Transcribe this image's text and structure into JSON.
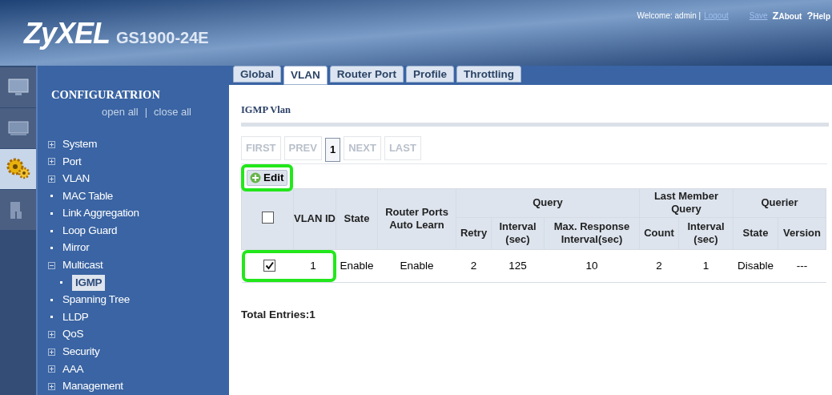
{
  "header": {
    "brand": "ZyXEL",
    "model": "GS1900-24E",
    "welcome": "Welcome: admin |",
    "logout": "Logout",
    "links": [
      {
        "label": "Save"
      },
      {
        "icon": "Z",
        "label": "About"
      },
      {
        "icon": "?",
        "label": "Help"
      }
    ]
  },
  "icon_strip": [
    {
      "kind": "monitor",
      "selected": false
    },
    {
      "kind": "screen",
      "selected": false
    },
    {
      "kind": "gears",
      "selected": true
    },
    {
      "kind": "person",
      "selected": false
    }
  ],
  "sidebar": {
    "title": "CONFIGURATRION",
    "open_all": "open all",
    "separator": "|",
    "close_all": "close all",
    "items": [
      {
        "label": "System",
        "kind": "folder",
        "expanded": false
      },
      {
        "label": "Port",
        "kind": "folder",
        "expanded": false
      },
      {
        "label": "VLAN",
        "kind": "folder",
        "expanded": false
      },
      {
        "label": "MAC Table",
        "kind": "leaf"
      },
      {
        "label": "Link Aggregation",
        "kind": "leaf"
      },
      {
        "label": "Loop Guard",
        "kind": "leaf"
      },
      {
        "label": "Mirror",
        "kind": "leaf"
      },
      {
        "label": "Multicast",
        "kind": "folder",
        "expanded": true,
        "children": [
          {
            "label": "IGMP",
            "kind": "leaf",
            "selected": true
          }
        ]
      },
      {
        "label": "Spanning Tree",
        "kind": "leaf"
      },
      {
        "label": "LLDP",
        "kind": "leaf"
      },
      {
        "label": "QoS",
        "kind": "folder",
        "expanded": false
      },
      {
        "label": "Security",
        "kind": "folder",
        "expanded": false
      },
      {
        "label": "AAA",
        "kind": "folder",
        "expanded": false
      },
      {
        "label": "Management",
        "kind": "folder",
        "expanded": false
      }
    ]
  },
  "tabs": [
    {
      "label": "Global",
      "selected": false
    },
    {
      "label": "VLAN",
      "selected": true
    },
    {
      "label": "Router Port",
      "selected": false
    },
    {
      "label": "Profile",
      "selected": false
    },
    {
      "label": "Throttling",
      "selected": false
    }
  ],
  "section_title": "IGMP Vlan",
  "pager": [
    {
      "label": "FIRST",
      "disabled": true
    },
    {
      "label": "PREV",
      "disabled": true
    },
    {
      "label": "1",
      "disabled": false
    },
    {
      "label": "NEXT",
      "disabled": true
    },
    {
      "label": "LAST",
      "disabled": true
    }
  ],
  "edit_button": {
    "label": "Edit",
    "highlighted": true
  },
  "table": {
    "select_all": false,
    "groups": [
      "Query",
      "Last Member Query",
      "Querier"
    ],
    "columns": [
      "VLAN ID",
      "State",
      "Router Ports Auto Learn",
      "Retry",
      "Interval (sec)",
      "Max. Response Interval(sec)",
      "Count",
      "Interval (sec)",
      "State",
      "Version"
    ],
    "rows": [
      {
        "checked": true,
        "highlighted": true,
        "cells": [
          "1",
          "Enable",
          "Enable",
          "2",
          "125",
          "10",
          "2",
          "1",
          "Disable",
          "---"
        ]
      }
    ]
  },
  "total": "Total Entries:1"
}
